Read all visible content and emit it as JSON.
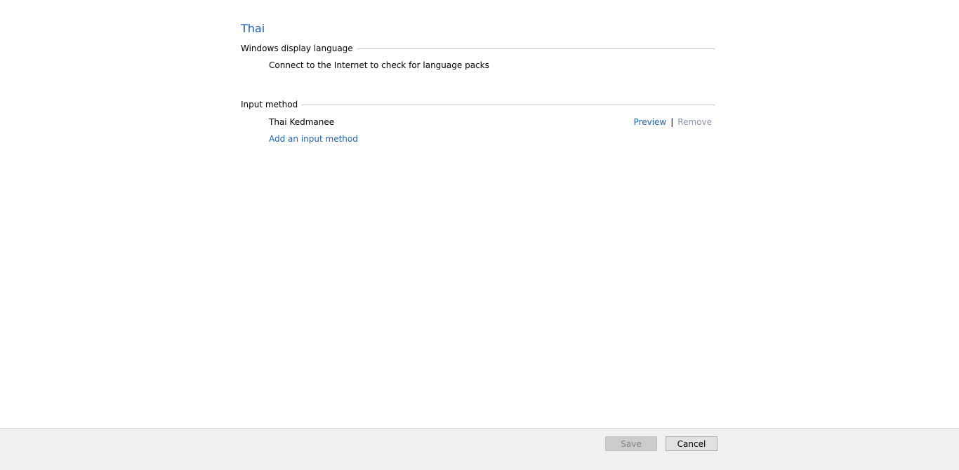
{
  "language": {
    "title": "Thai"
  },
  "display_language": {
    "header": "Windows display language",
    "message": "Connect to the Internet to check for language packs"
  },
  "input_method": {
    "header": "Input method",
    "methods": [
      {
        "name": "Thai Kedmanee",
        "preview_label": "Preview",
        "separator": "|",
        "remove_label": "Remove"
      }
    ],
    "add_label": "Add an input method"
  },
  "footer": {
    "save_label": "Save",
    "cancel_label": "Cancel"
  },
  "colors": {
    "title": "#1e5aa8",
    "link": "#1e63b4",
    "disabled_link": "#8a94a6",
    "footer_bg": "#f0f0f0"
  }
}
